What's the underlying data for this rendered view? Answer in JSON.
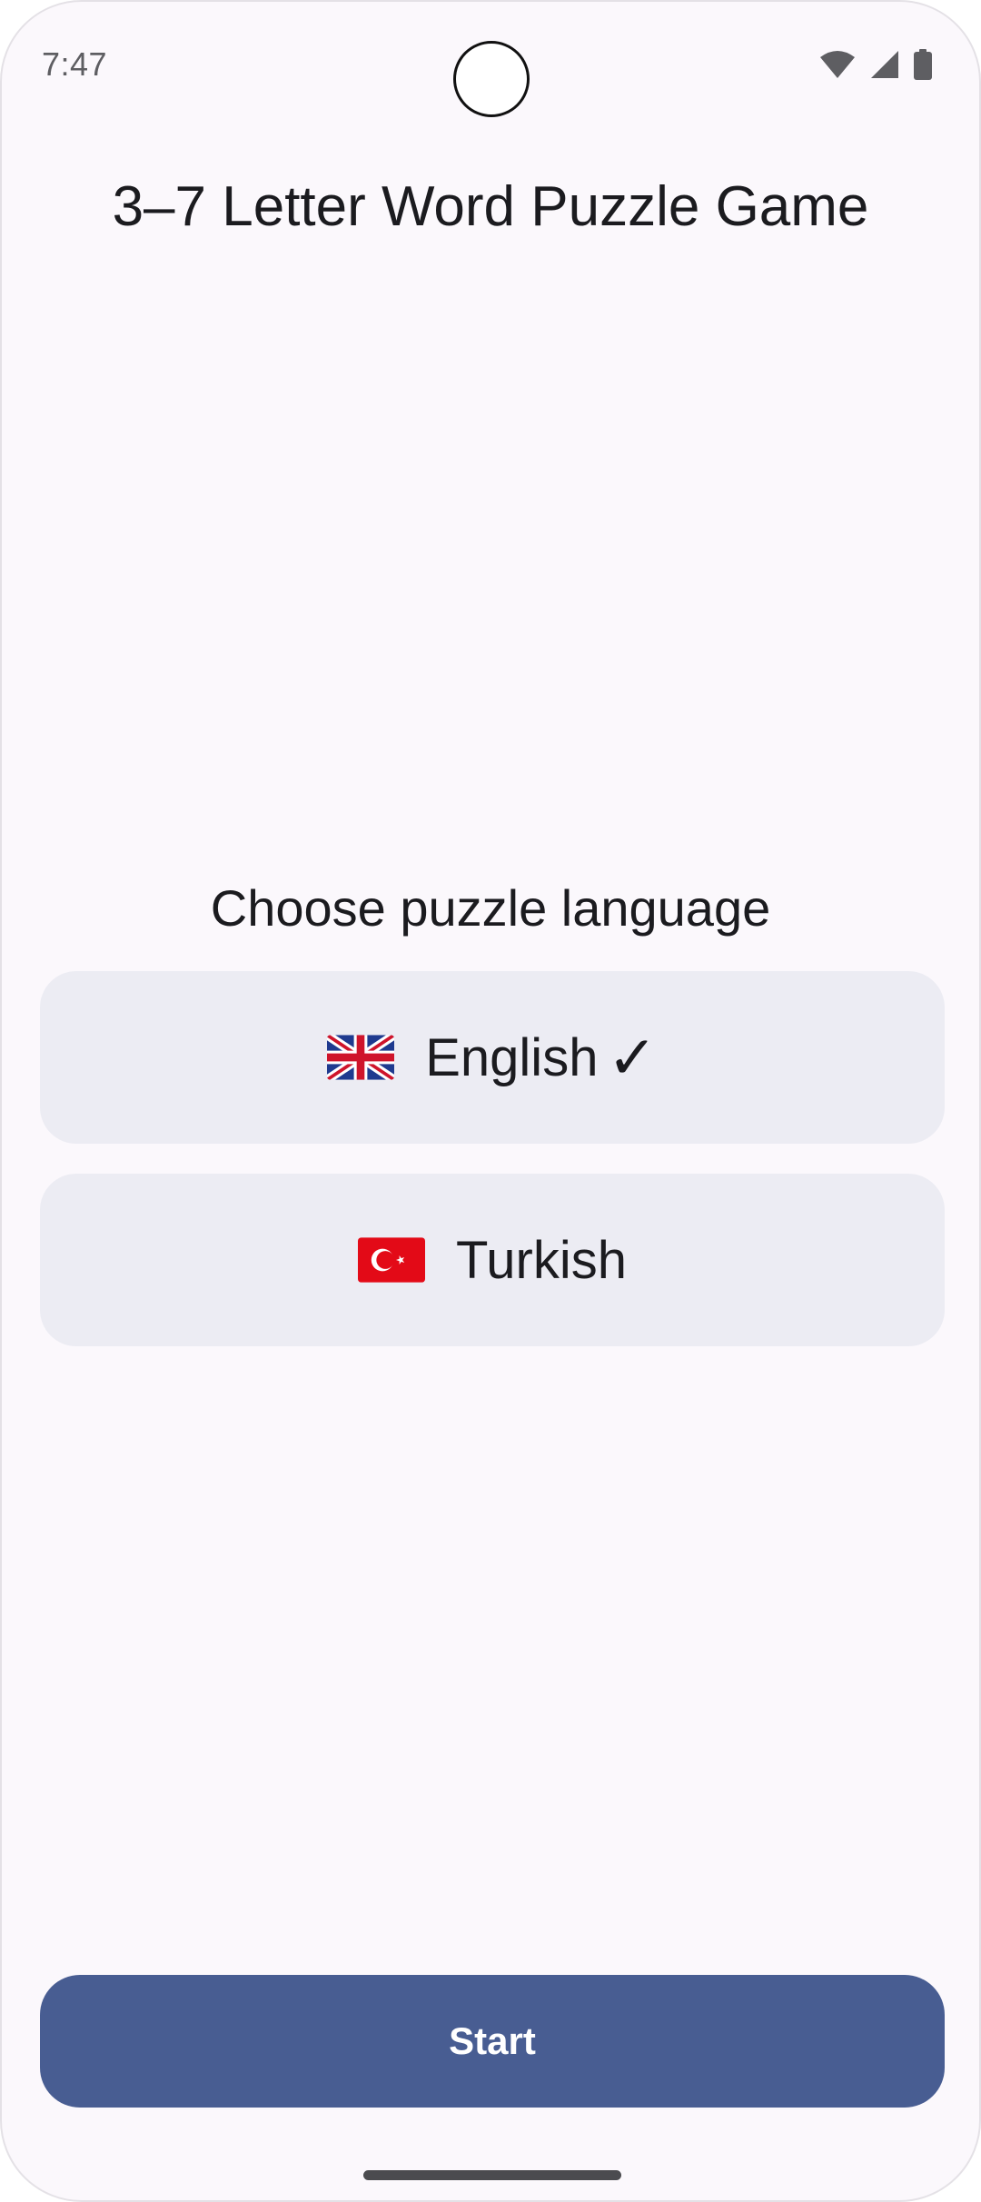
{
  "status_bar": {
    "time": "7:47",
    "icons": [
      "wifi-icon",
      "signal-icon",
      "battery-icon"
    ]
  },
  "app": {
    "title": "3–7 Letter Word Puzzle Game"
  },
  "language_picker": {
    "prompt": "Choose puzzle language",
    "options": [
      {
        "flag": "uk-flag-icon",
        "label": "English",
        "selected": true,
        "check": "✓"
      },
      {
        "flag": "turkey-flag-icon",
        "label": "Turkish",
        "selected": false
      }
    ]
  },
  "actions": {
    "start_label": "Start"
  },
  "colors": {
    "background": "#fbf8fc",
    "option_bg": "#ececf3",
    "primary": "#485d92",
    "text": "#1b1b1f"
  }
}
